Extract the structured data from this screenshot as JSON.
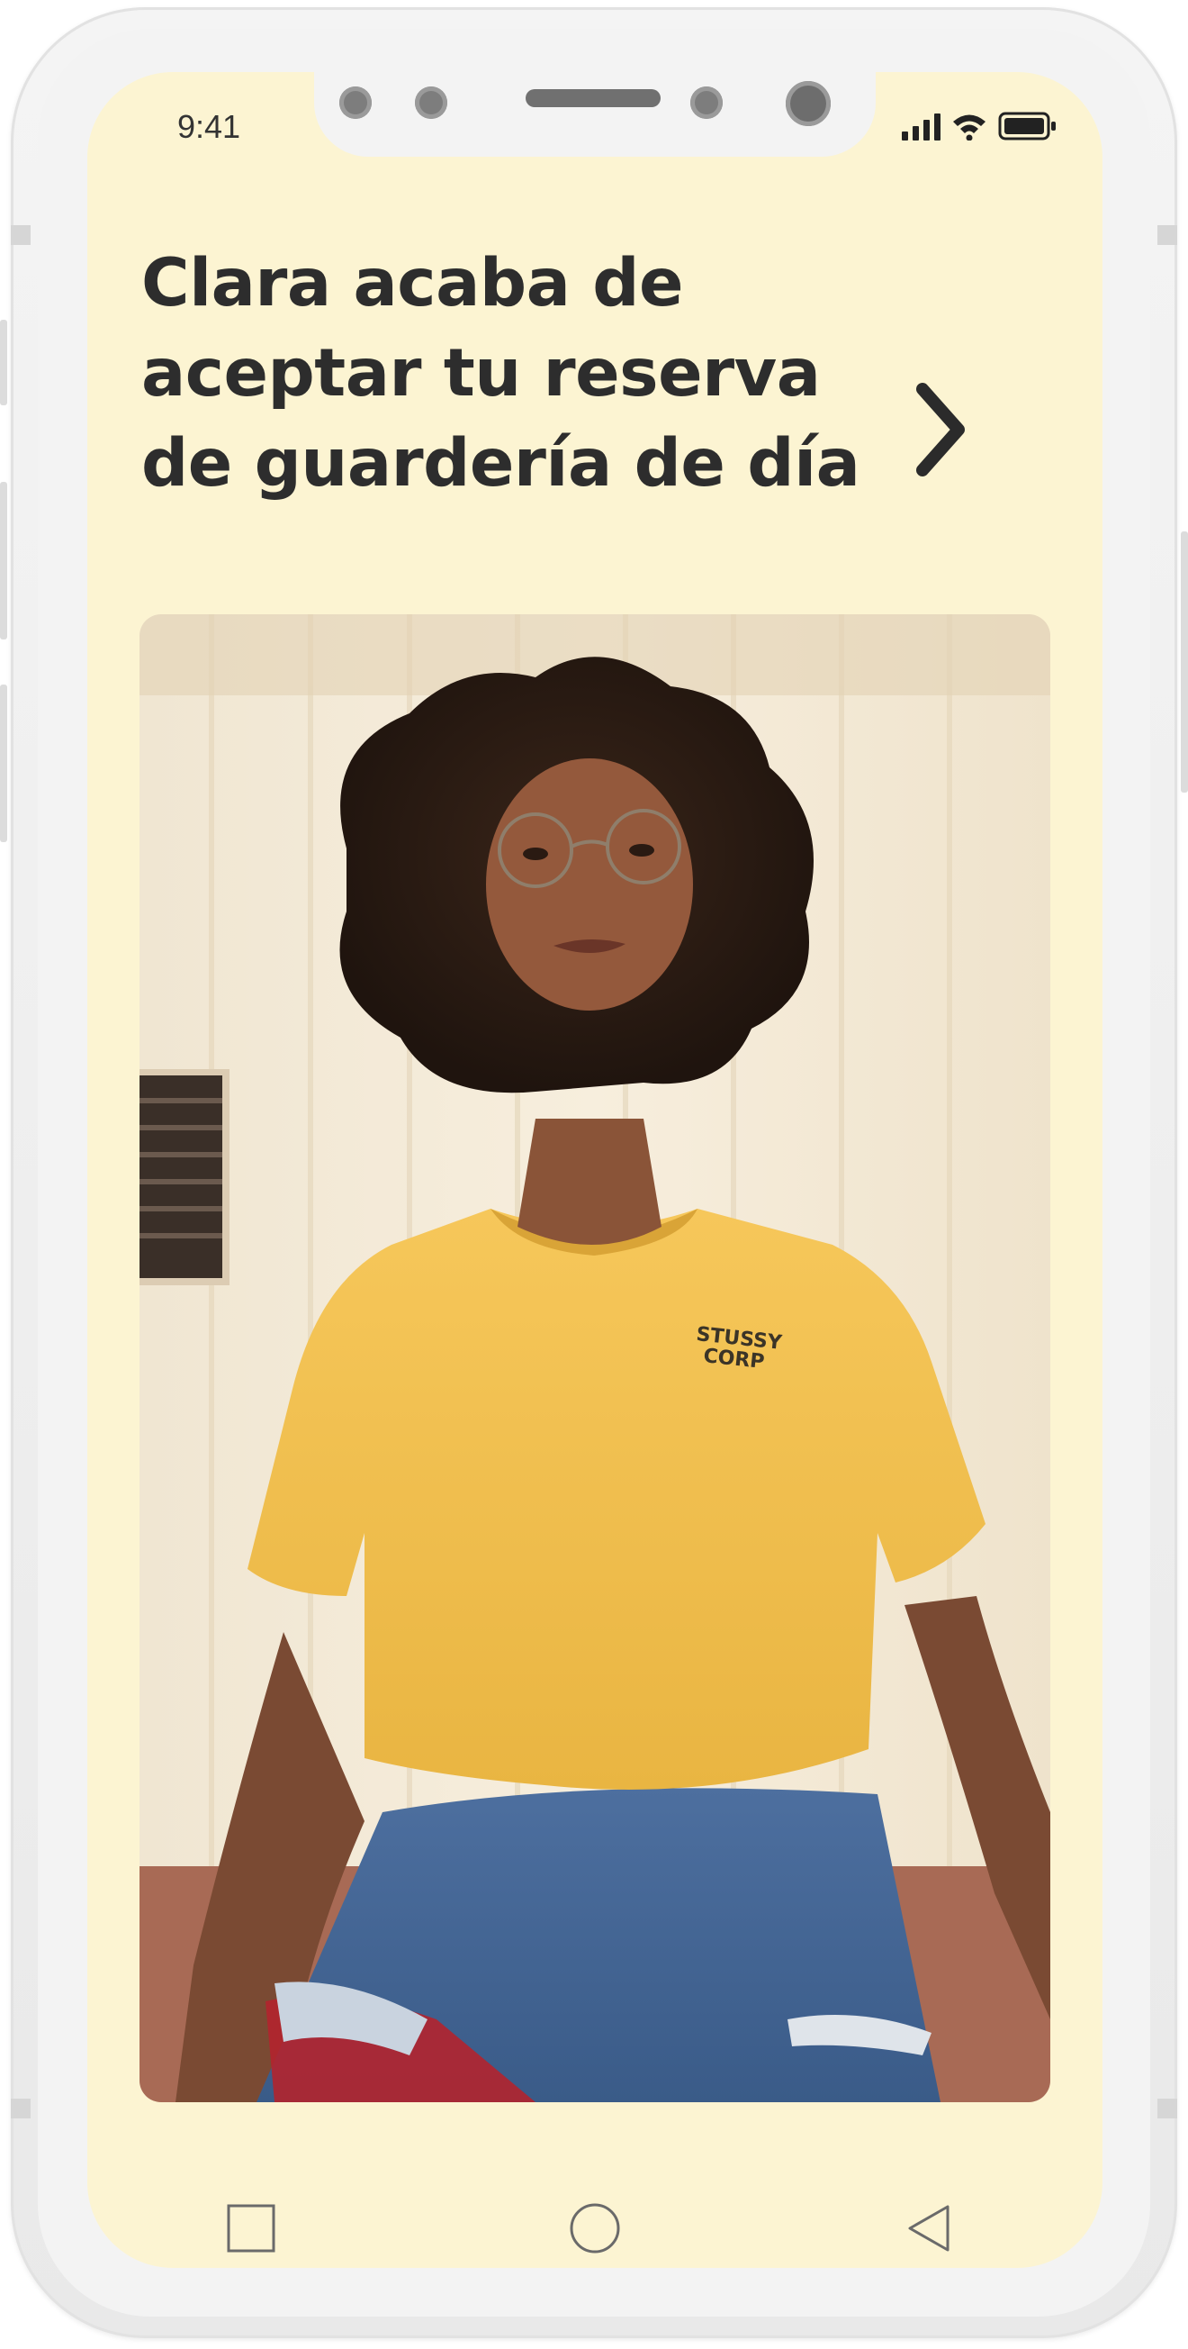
{
  "status_bar": {
    "time": "9:41"
  },
  "notification": {
    "headline_lines": [
      "Clara acaba de",
      "aceptar tu reserva",
      "de guardería de día"
    ],
    "open_icon": "chevron-right-icon"
  },
  "photo": {
    "subject": "profile-photo",
    "shirt_text": [
      "STUSSY",
      "CORP"
    ]
  },
  "nav_bar": {
    "icons": [
      "square-recents-icon",
      "circle-home-icon",
      "triangle-back-icon"
    ]
  },
  "colors": {
    "screen_background": "#fcf4d2",
    "text": "#2d2d2d",
    "shirt": "#f2c24d"
  }
}
